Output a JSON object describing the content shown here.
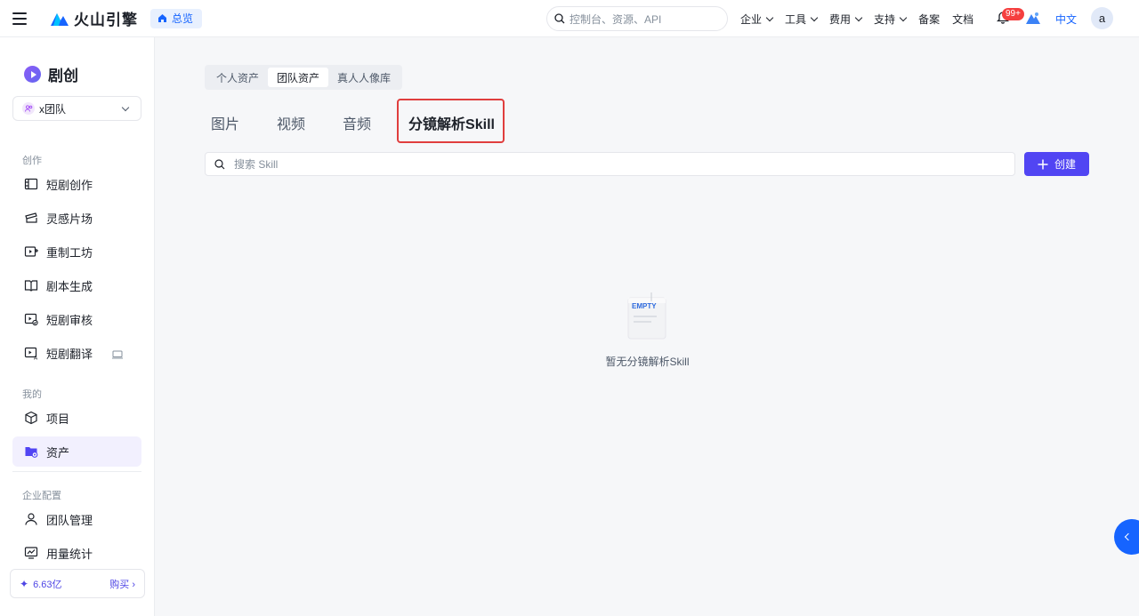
{
  "topbar": {
    "menu_icon": "hamburger-menu-icon",
    "logo_text": "火山引擎",
    "overview_label": "总览",
    "search_placeholder": "控制台、资源、API",
    "nav": [
      {
        "label": "企业",
        "has_dropdown": true
      },
      {
        "label": "工具",
        "has_dropdown": true
      },
      {
        "label": "费用",
        "has_dropdown": true
      },
      {
        "label": "支持",
        "has_dropdown": true
      },
      {
        "label": "备案",
        "has_dropdown": false
      },
      {
        "label": "文档",
        "has_dropdown": false
      }
    ],
    "notification_badge": "99+",
    "language": "中文",
    "avatar_letter": "a"
  },
  "sidebar": {
    "app_name": "剧创",
    "team": "x团队",
    "groups": {
      "create": "创作",
      "mine": "我的",
      "enterprise": "企业配置"
    },
    "items": {
      "short_drama": "短剧创作",
      "inspiration": "灵感片场",
      "remake": "重制工坊",
      "script": "剧本生成",
      "review": "短剧审核",
      "translate": "短剧翻译",
      "project": "项目",
      "assets": "资产",
      "team_manage": "团队管理",
      "usage": "用量统计"
    },
    "quota_value": "6.63亿",
    "buy_label": "购买 ›"
  },
  "main": {
    "asset_scopes": [
      "个人资产",
      "团队资产",
      "真人人像库"
    ],
    "active_scope": "团队资产",
    "tabs": [
      "图片",
      "视频",
      "音频",
      "分镜解析Skill"
    ],
    "active_tab": "分镜解析Skill",
    "search_placeholder": "搜索 Skill",
    "create_label": "创建",
    "empty_badge": "EMPTY",
    "empty_text": "暂无分镜解析Skill"
  },
  "colors": {
    "brand": "#1664ff",
    "primary_button": "#5145f3",
    "highlight_box": "#e03e3e"
  }
}
